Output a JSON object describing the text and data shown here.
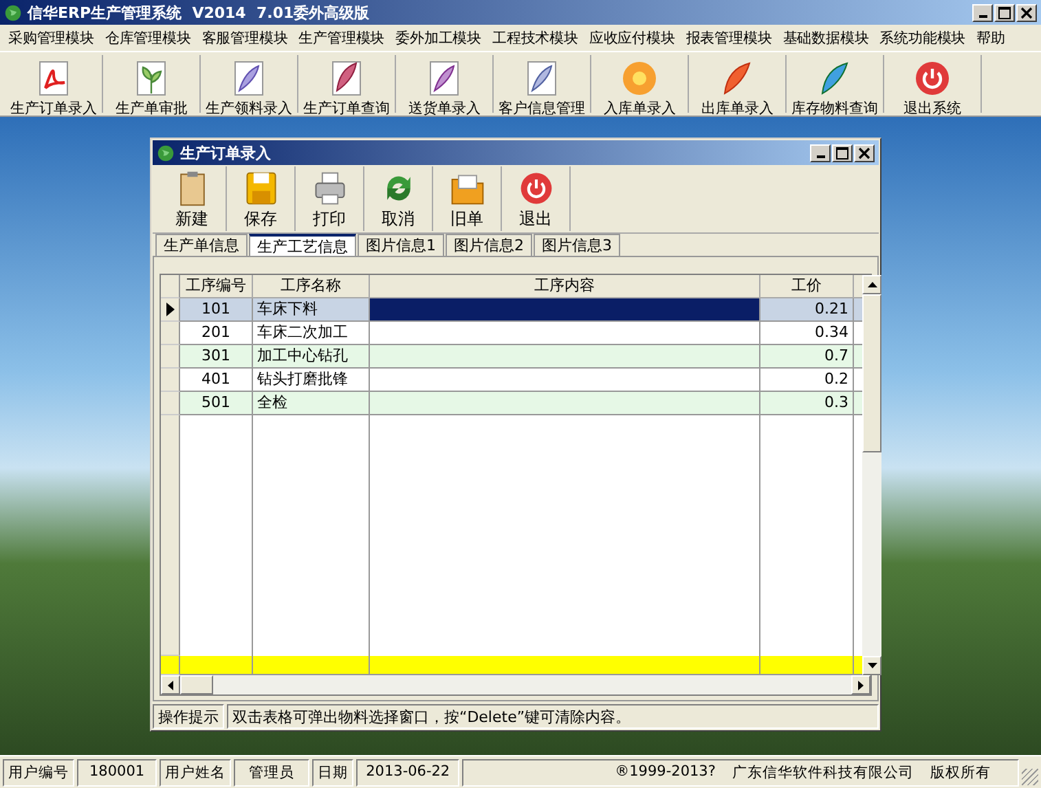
{
  "window": {
    "title": "信华ERP生产管理系统  V2014  7.01委外高级版"
  },
  "menu": [
    "采购管理模块",
    "仓库管理模块",
    "客服管理模块",
    "生产管理模块",
    "委外加工模块",
    "工程技术模块",
    "应收应付模块",
    "报表管理模块",
    "基础数据模块",
    "系统功能模块",
    "帮助"
  ],
  "toolbar": [
    "生产订单录入",
    "生产单审批",
    "生产领料录入",
    "生产订单查询",
    "送货单录入",
    "客户信息管理",
    "入库单录入",
    "出库单录入",
    "库存物料查询",
    "退出系统"
  ],
  "child_window": {
    "title": "生产订单录入",
    "toolbar": [
      "新建",
      "保存",
      "打印",
      "取消",
      "旧单",
      "退出"
    ],
    "tabs": [
      {
        "label": "生产单信息",
        "selected": false
      },
      {
        "label": "生产工艺信息",
        "selected": true
      },
      {
        "label": "图片信息1",
        "selected": false
      },
      {
        "label": "图片信息2",
        "selected": false
      },
      {
        "label": "图片信息3",
        "selected": false
      }
    ],
    "table": {
      "columns": [
        "工序编号",
        "工序名称",
        "工序内容",
        "工价"
      ],
      "rows": [
        {
          "cells": [
            "101",
            "车床下料",
            "",
            "0.21"
          ],
          "selected": true
        },
        {
          "cells": [
            "201",
            "车床二次加工",
            "",
            "0.34"
          ],
          "selected": false
        },
        {
          "cells": [
            "301",
            "加工中心钻孔",
            "",
            "0.7"
          ],
          "selected": false
        },
        {
          "cells": [
            "401",
            "钻头打磨批锋",
            "",
            "0.2"
          ],
          "selected": false
        },
        {
          "cells": [
            "501",
            "全检",
            "",
            "0.3"
          ],
          "selected": false
        }
      ]
    },
    "hint": {
      "label": "操作提示",
      "text": "双击表格可弹出物料选择窗口，按“Delete”键可清除内容。"
    }
  },
  "status_bar": {
    "user_id_label": "用户编号",
    "user_id": "180001",
    "user_name_label": "用户姓名",
    "user_name": "管理员",
    "date_label": "日期",
    "date": "2013-06-22",
    "copyright": "®1999-2013?",
    "company": "广东信华软件科技有限公司",
    "rights": "版权所有"
  }
}
